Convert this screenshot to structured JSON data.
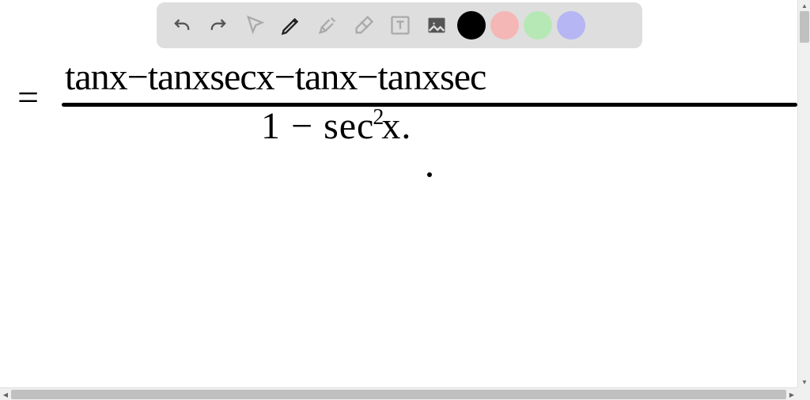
{
  "toolbar": {
    "tools": {
      "undo": "undo",
      "redo": "redo",
      "pointer": "pointer",
      "pencil": "pencil",
      "tools_menu": "tools",
      "eraser": "eraser",
      "text": "text",
      "image": "image"
    },
    "colors": {
      "black": "#000000",
      "red": "#f5b6b6",
      "green": "#b6e8b6",
      "purple": "#b6b6f5"
    },
    "selected_tool": "pencil",
    "selected_color": "black"
  },
  "equation": {
    "equals": "=",
    "numerator": "tanx−tanxsecx−tanx−tanxsec",
    "denominator_pre": "1 − sec",
    "denominator_exp": "2",
    "denominator_post": "x."
  }
}
